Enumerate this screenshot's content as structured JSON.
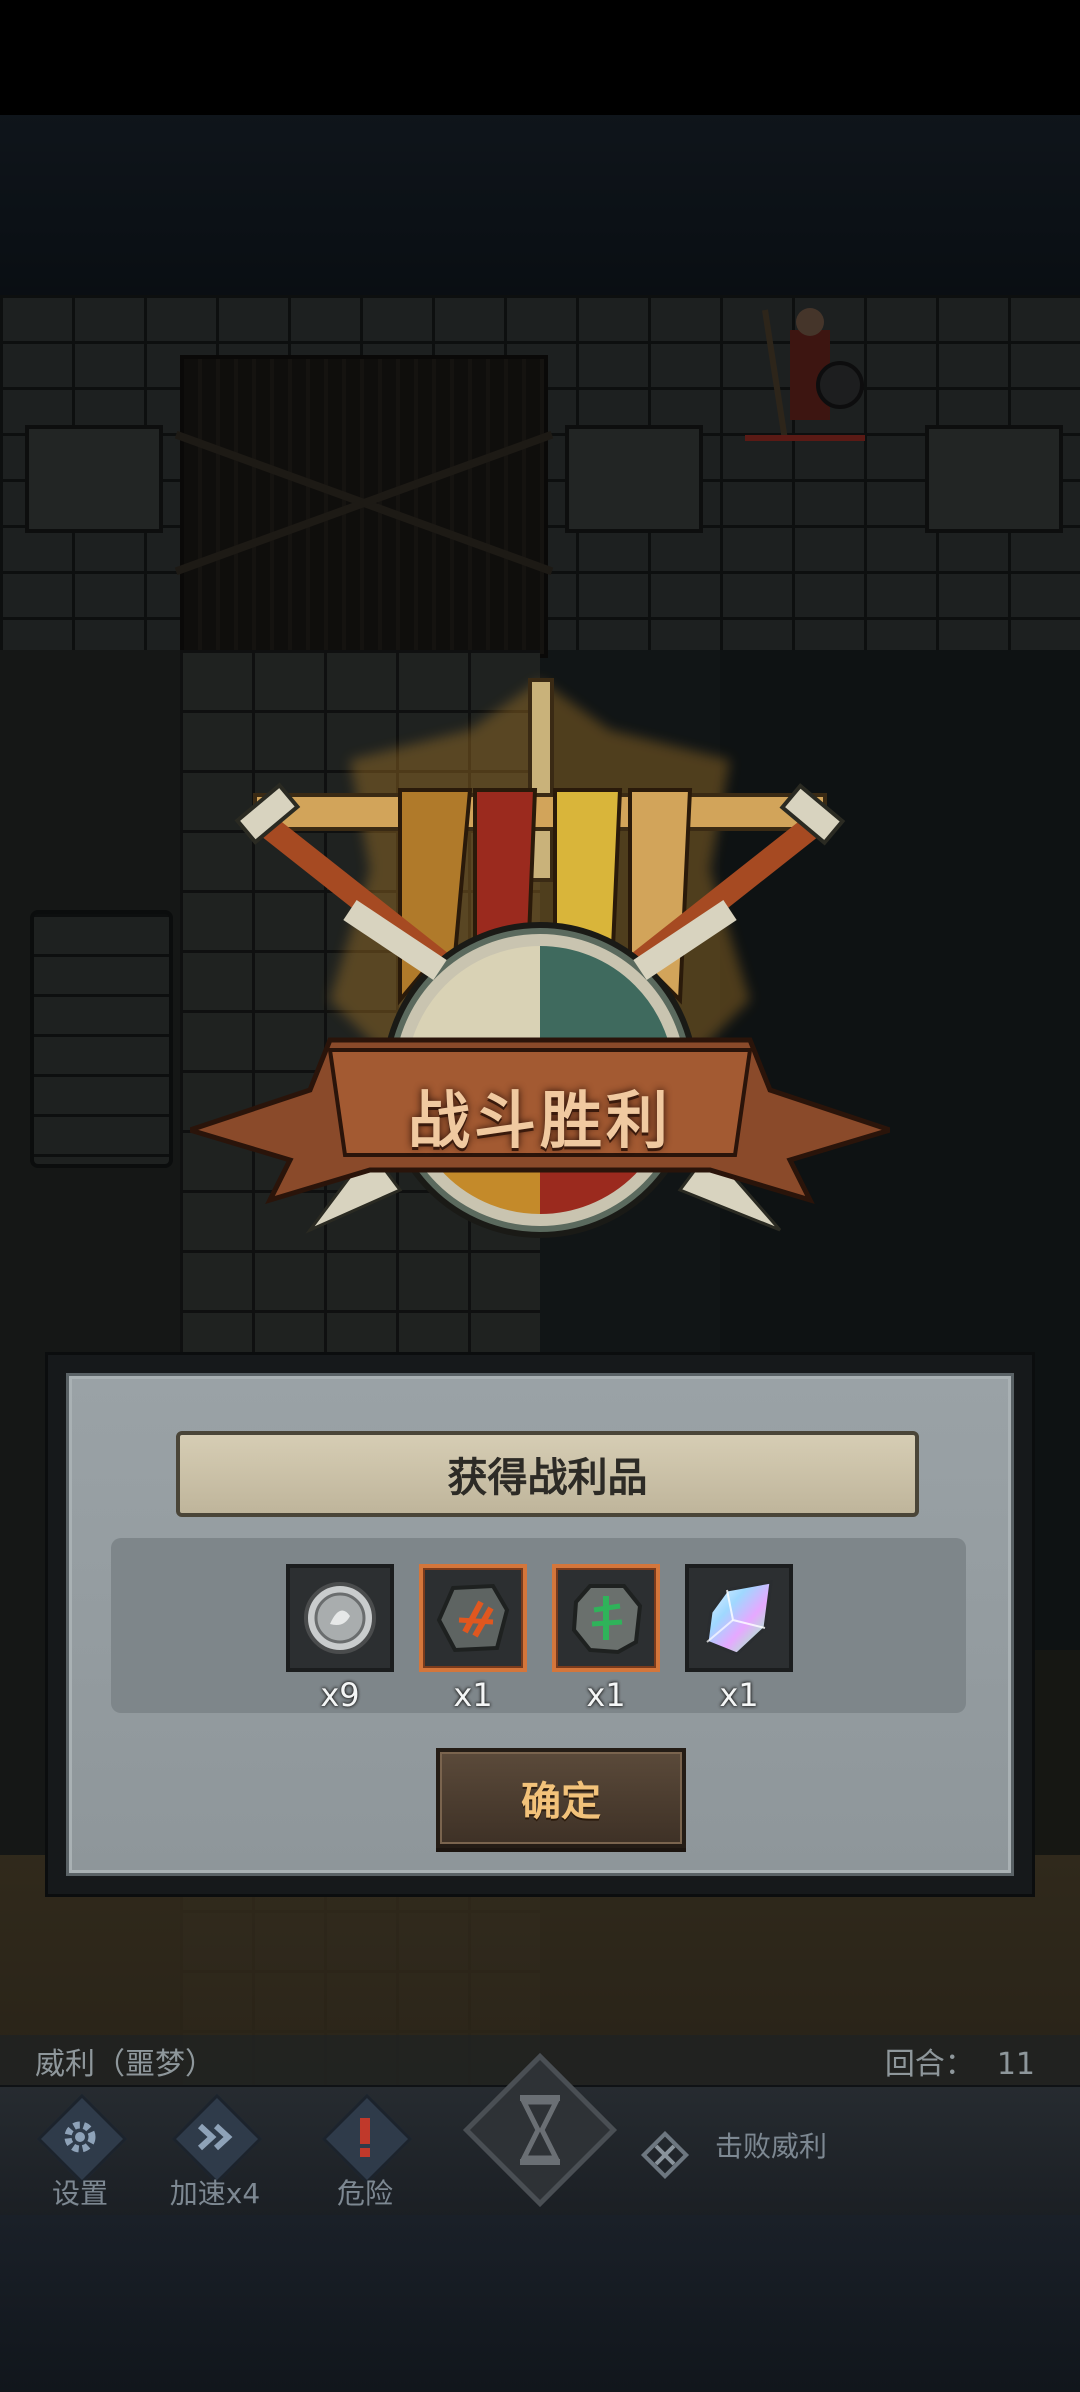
{
  "victory": {
    "title": "战斗胜利"
  },
  "loot": {
    "header": "获得战利品",
    "items": [
      {
        "name": "silver-coin-icon",
        "qty": "x9"
      },
      {
        "name": "red-rune-stone-icon",
        "qty": "x1"
      },
      {
        "name": "green-rune-stone-icon",
        "qty": "x1"
      },
      {
        "name": "rainbow-crystal-icon",
        "qty": "x1"
      }
    ],
    "confirm_label": "确定"
  },
  "status": {
    "boss_name": "威利（噩梦）",
    "turn_label": "回合：",
    "turn_value": "11"
  },
  "controls": {
    "settings_label": "设置",
    "speed_label": "加速x4",
    "danger_label": "危险",
    "objective_label": "击败威利"
  },
  "colors": {
    "accent_orange": "#d4763b",
    "title_text": "#f0c9a0",
    "button_text": "#f2c27a"
  }
}
